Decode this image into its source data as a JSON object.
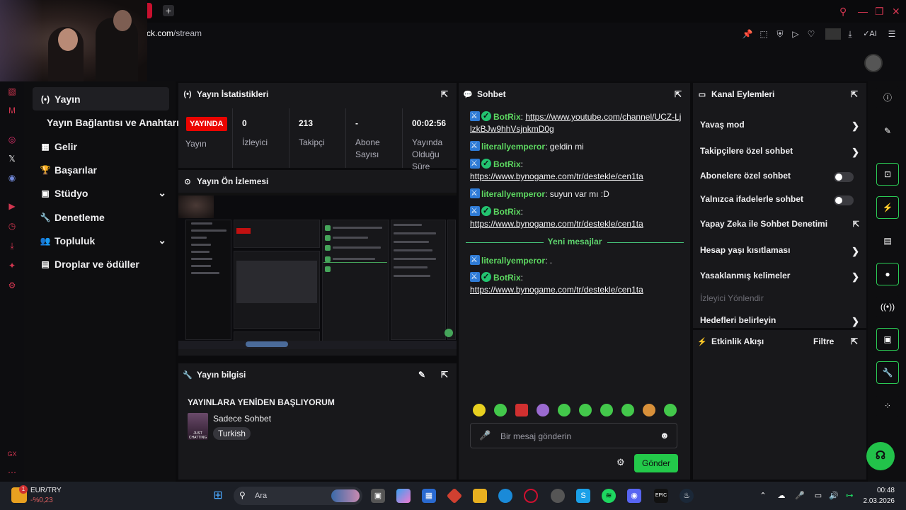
{
  "browser": {
    "url_host": "ck.com",
    "url_path": "/stream",
    "ai_label": "AI"
  },
  "colors": {
    "accent_green": "#23c94a",
    "live_red": "#eb0400",
    "username_green": "#5dd861",
    "browser_red": "#d23650"
  },
  "sidebar": {
    "items": [
      {
        "label": "Yayın",
        "icon": "broadcast-icon",
        "active": true
      },
      {
        "label": "Yayın Bağlantısı ve Anahtarı",
        "icon": "",
        "active": false
      },
      {
        "label": "Gelir",
        "icon": "grid-icon",
        "active": false
      },
      {
        "label": "Başarılar",
        "icon": "trophy-icon",
        "active": false
      },
      {
        "label": "Stüdyo",
        "icon": "film-icon",
        "active": false
      },
      {
        "label": "Denetleme",
        "icon": "wrench-icon",
        "active": false
      },
      {
        "label": "Topluluk",
        "icon": "people-icon",
        "active": false
      },
      {
        "label": "Droplar ve ödüller",
        "icon": "gift-icon",
        "active": false
      }
    ]
  },
  "stats": {
    "title": "Yayın İstatistikleri",
    "live_badge": "YAYINDA",
    "status_label": "Yayın",
    "viewers_value": "0",
    "viewers_label": "İzleyici",
    "followers_value": "213",
    "followers_label": "Takipçi",
    "subs_value": "-",
    "subs_label": "Abone Sayısı",
    "uptime_value": "00:02:56",
    "uptime_label": "Yayında Olduğu Süre"
  },
  "preview": {
    "title": "Yayın Ön İzlemesi"
  },
  "stream_info": {
    "title": "Yayın bilgisi",
    "stream_title": "YAYINLARA YENİDEN BAŞLIYORUM",
    "category": "Sadece Sohbet",
    "tag": "Turkish",
    "thumb_text": "JUST CHATTING"
  },
  "chat": {
    "title": "Sohbet",
    "messages": [
      {
        "user": "BotRix",
        "verified": true,
        "text": "https://www.youtube.com/channel/UCZ-LjlzkBJw9hhVsjnkmD0g",
        "is_link": true
      },
      {
        "user": "literallyemperor",
        "verified": false,
        "text": "geldin mi",
        "is_link": false
      },
      {
        "user": "BotRix",
        "verified": true,
        "text": "https://www.bynogame.com/tr/destekle/cen1ta",
        "is_link": true
      },
      {
        "user": "literallyemperor",
        "verified": false,
        "text": "suyun var mı :D",
        "is_link": false
      },
      {
        "user": "BotRix",
        "verified": true,
        "text": "https://www.bynogame.com/tr/destekle/cen1ta",
        "is_link": true
      }
    ],
    "new_messages_label": "Yeni mesajlar",
    "new_messages": [
      {
        "user": "literallyemperor",
        "verified": false,
        "text": ".",
        "is_link": false
      },
      {
        "user": "BotRix",
        "verified": true,
        "text": "https://www.bynogame.com/tr/destekle/cen1ta",
        "is_link": true
      }
    ],
    "input_placeholder": "Bir mesaj gönderin",
    "send_label": "Gönder"
  },
  "channel_actions": {
    "title": "Kanal Eylemleri",
    "items": [
      {
        "label": "Yavaş mod",
        "control": "chevron"
      },
      {
        "label": "Takipçilere özel sohbet",
        "control": "chevron"
      },
      {
        "label": "Abonelere özel sohbet",
        "control": "toggle"
      },
      {
        "label": "Yalnızca ifadelerle sohbet",
        "control": "toggle"
      },
      {
        "label": "Yapay Zeka ile Sohbet Denetimi",
        "control": "external"
      },
      {
        "label": "Hesap yaşı kısıtlaması",
        "control": "chevron"
      },
      {
        "label": "Yasaklanmış kelimeler",
        "control": "chevron"
      },
      {
        "label": "İzleyici Yönlendir",
        "control": "disabled"
      },
      {
        "label": "Hedefleri belirleyin",
        "control": "chevron"
      }
    ]
  },
  "activity": {
    "title": "Etkinlik Akışı",
    "filter_label": "Filtre"
  },
  "taskbar": {
    "ticker_name": "EUR/TRY",
    "ticker_change": "-%0,23",
    "ticker_badge": "1",
    "search_placeholder": "Ara",
    "time": "00:48",
    "date": "2.03.2026"
  }
}
